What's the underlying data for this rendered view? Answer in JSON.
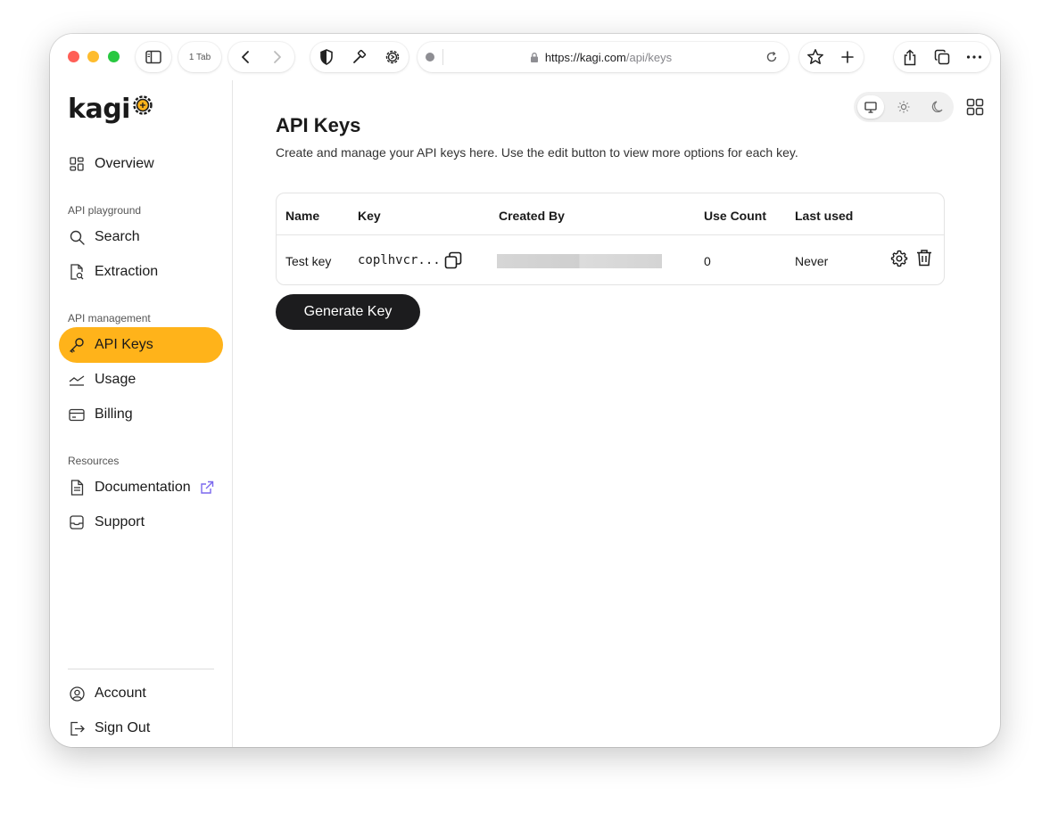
{
  "browser": {
    "tab_count": "1 Tab",
    "url_host": "https://kagi.com",
    "url_path": "/api/keys"
  },
  "sidebar": {
    "logo": "kagi",
    "overview": "Overview",
    "sections": {
      "playground": "API playground",
      "management": "API management",
      "resources": "Resources"
    },
    "playground_items": [
      "Search",
      "Extraction"
    ],
    "management_items": [
      "API Keys",
      "Usage",
      "Billing"
    ],
    "resources_items": [
      "Documentation",
      "Support"
    ],
    "footer_items": [
      "Account",
      "Sign Out"
    ],
    "active": "API Keys"
  },
  "main": {
    "title": "API Keys",
    "subtitle": "Create and manage your API keys here. Use the edit button to view more options for each key.",
    "table": {
      "headers": [
        "Name",
        "Key",
        "Created By",
        "Use Count",
        "Last used"
      ],
      "rows": [
        {
          "name": "Test key",
          "key": "coplhvcr...",
          "use_count": "0",
          "last_used": "Never"
        }
      ]
    },
    "generate_button": "Generate Key"
  },
  "colors": {
    "accent": "#ffb31a",
    "button_dark": "#1c1c1e"
  }
}
